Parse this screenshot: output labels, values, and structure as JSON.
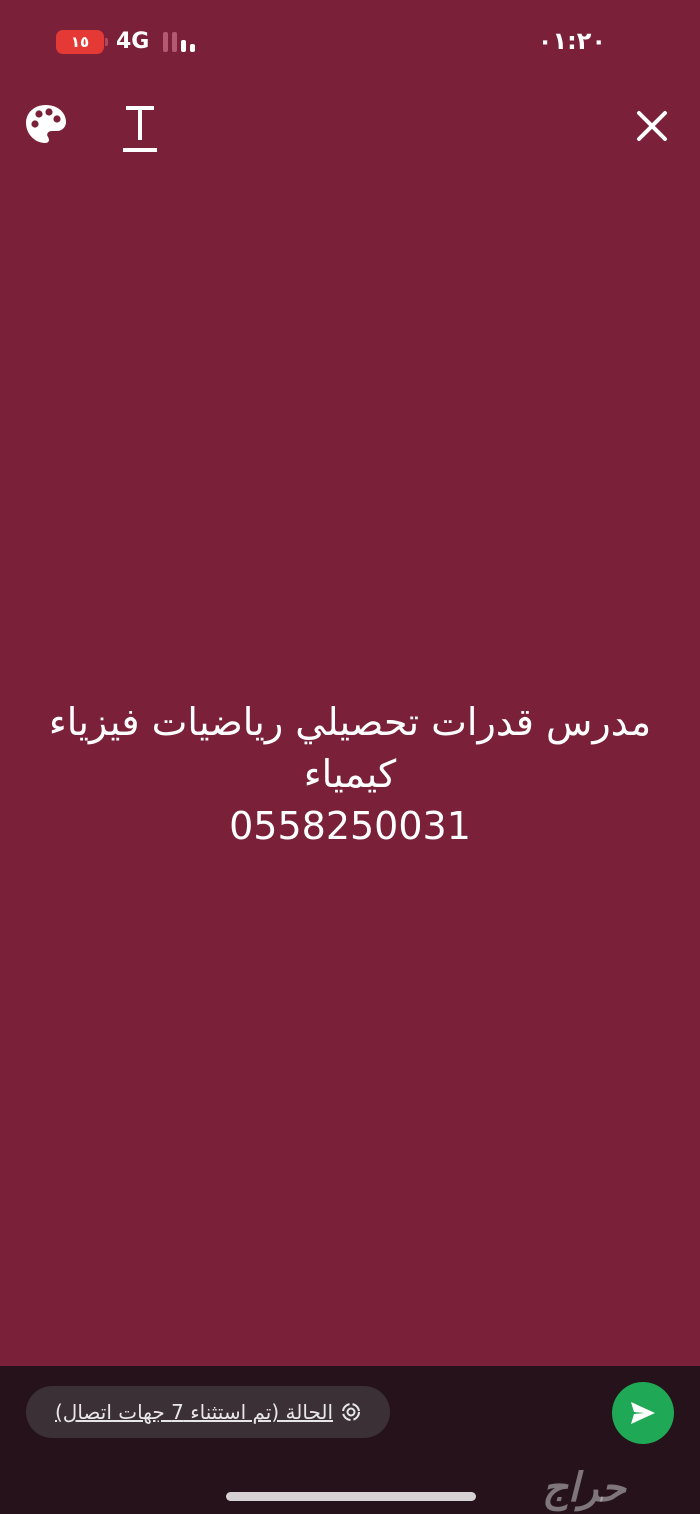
{
  "status_bar": {
    "battery": "١٥",
    "network": "4G",
    "time": "٠١:٢٠"
  },
  "toolbar": {
    "palette_icon": "palette-icon",
    "text_icon": "text-format-icon",
    "close_icon": "close-icon"
  },
  "status_post": {
    "text": "مدرس قدرات تحصيلي رياضيات فيزياء\nكيمياء\n0558250031",
    "background_color": "#7a2139"
  },
  "bottom_bar": {
    "audience_label": "الحالة (تم استثناء 7 جهات اتصال)",
    "send_icon": "send-icon",
    "send_color": "#1fa855"
  },
  "watermark": "حراج"
}
